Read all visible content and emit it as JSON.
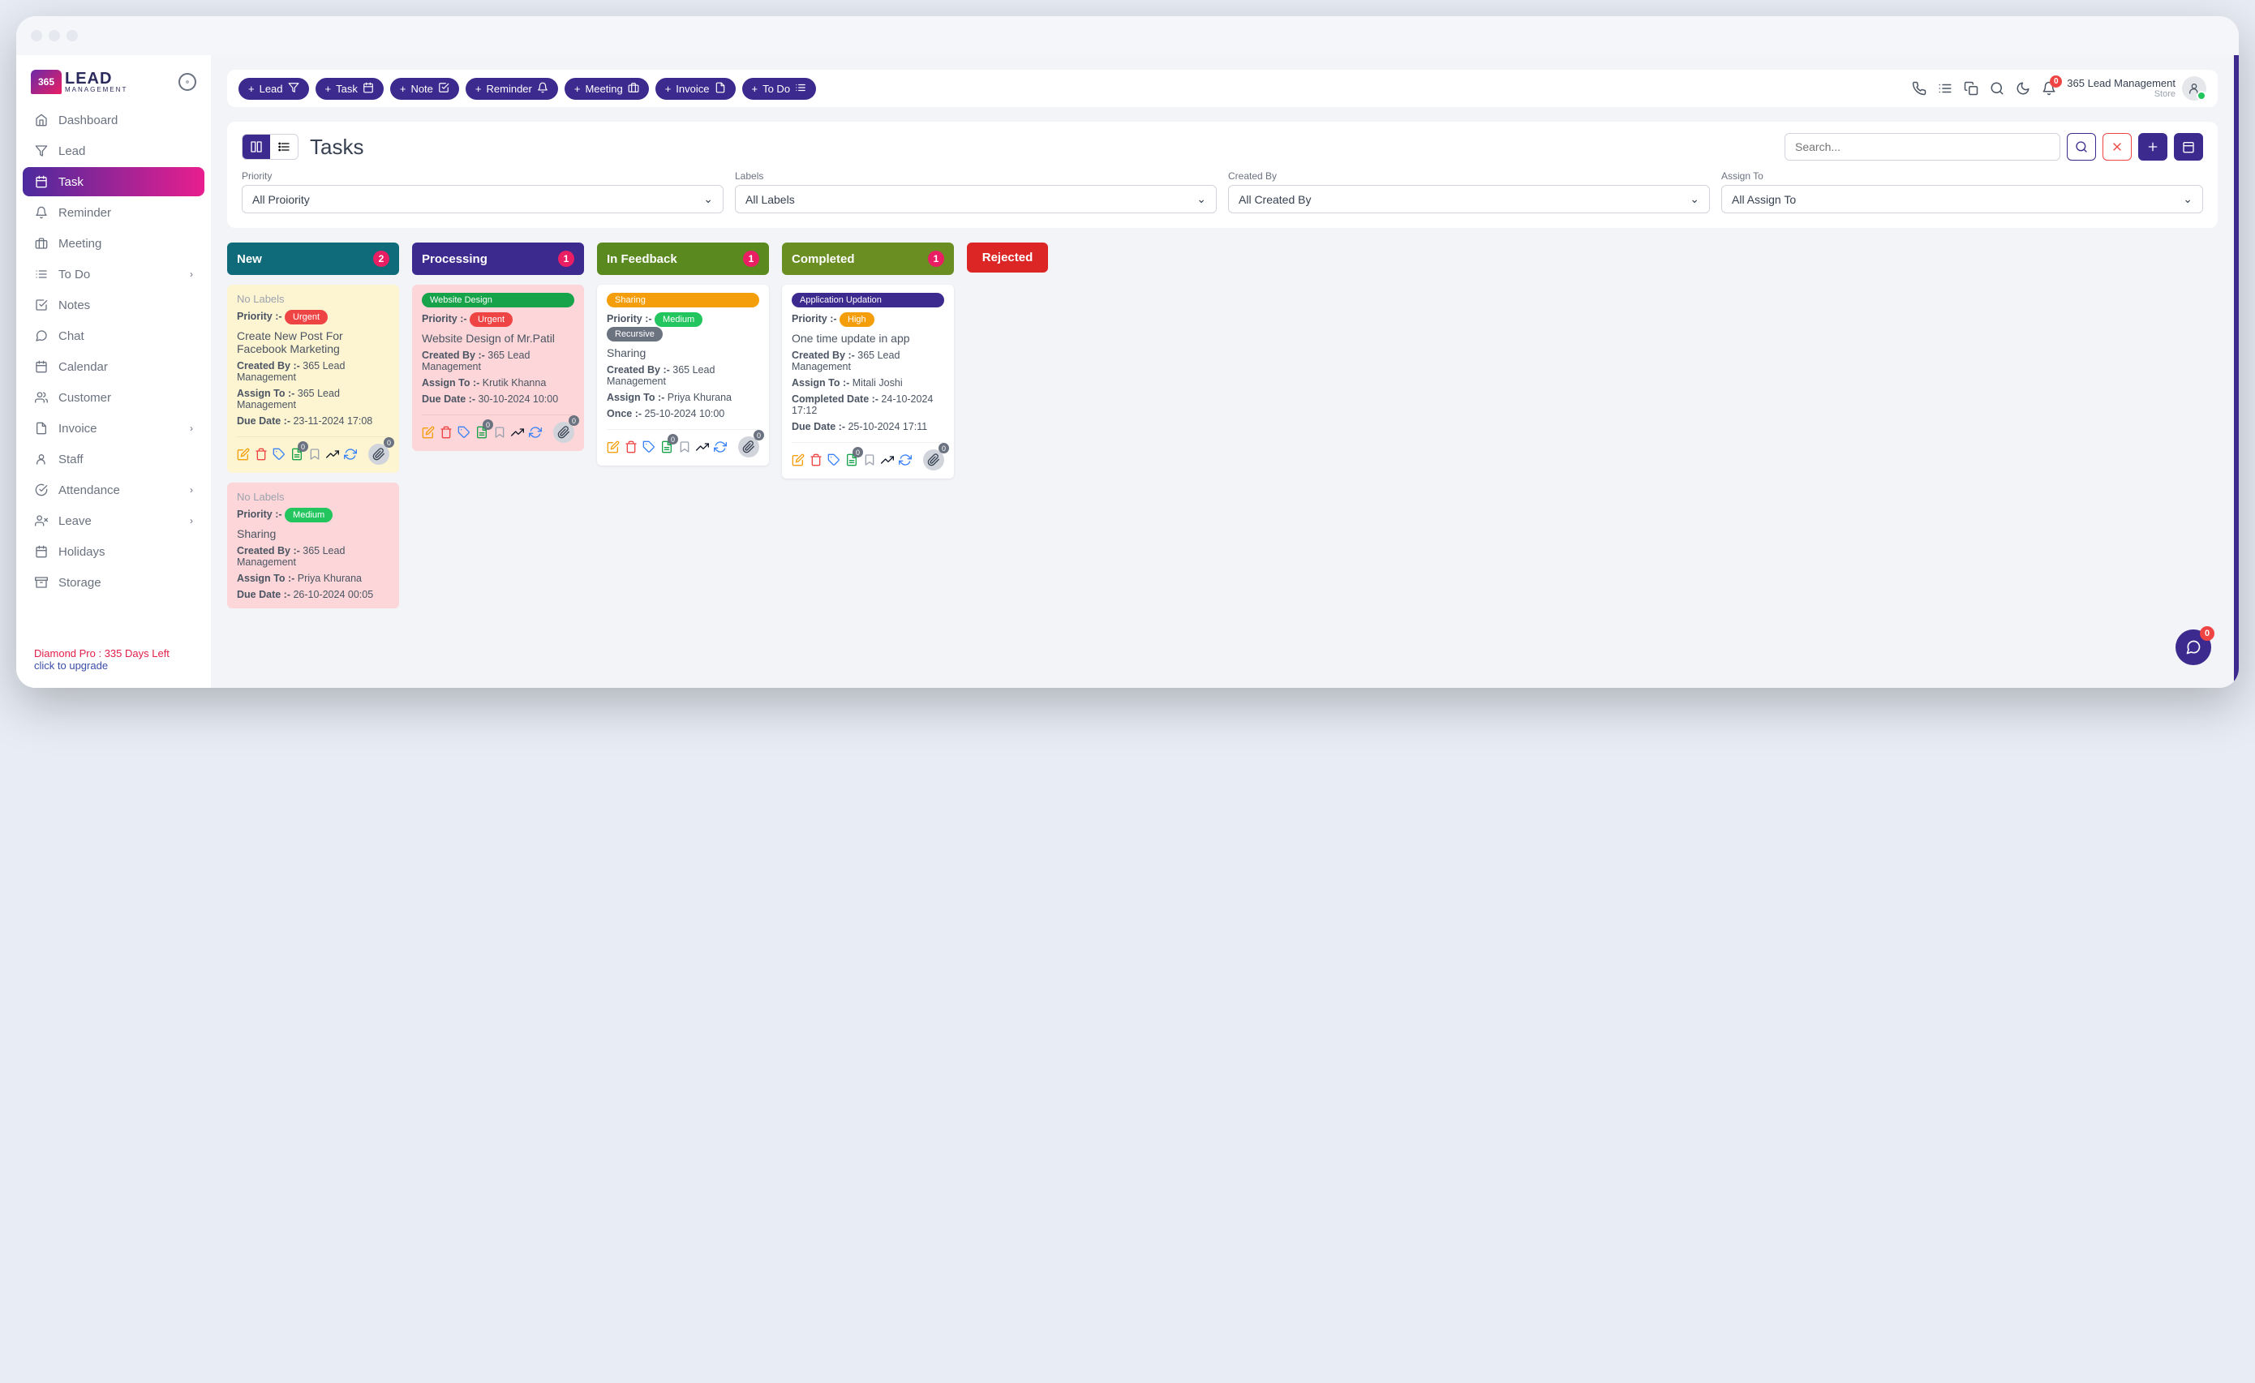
{
  "header": {
    "logo_365": "365",
    "logo_lead": "LEAD",
    "logo_mgmt": "MANAGEMENT",
    "user_name": "365 Lead Management",
    "user_role": "Store",
    "notification_count": "0"
  },
  "toolbar": {
    "pills": [
      {
        "label": "Lead",
        "icon": "funnel"
      },
      {
        "label": "Task",
        "icon": "calendar"
      },
      {
        "label": "Note",
        "icon": "check-square"
      },
      {
        "label": "Reminder",
        "icon": "bell"
      },
      {
        "label": "Meeting",
        "icon": "briefcase"
      },
      {
        "label": "Invoice",
        "icon": "file"
      },
      {
        "label": "To Do",
        "icon": "list"
      }
    ]
  },
  "sidebar": {
    "items": [
      {
        "label": "Dashboard",
        "icon": "home"
      },
      {
        "label": "Lead",
        "icon": "funnel"
      },
      {
        "label": "Task",
        "icon": "calendar",
        "active": true
      },
      {
        "label": "Reminder",
        "icon": "bell"
      },
      {
        "label": "Meeting",
        "icon": "briefcase"
      },
      {
        "label": "To Do",
        "icon": "list",
        "expandable": true
      },
      {
        "label": "Notes",
        "icon": "check-square"
      },
      {
        "label": "Chat",
        "icon": "chat"
      },
      {
        "label": "Calendar",
        "icon": "calendar"
      },
      {
        "label": "Customer",
        "icon": "users"
      },
      {
        "label": "Invoice",
        "icon": "file",
        "expandable": true
      },
      {
        "label": "Staff",
        "icon": "user"
      },
      {
        "label": "Attendance",
        "icon": "check-circle",
        "expandable": true
      },
      {
        "label": "Leave",
        "icon": "user-x",
        "expandable": true
      },
      {
        "label": "Holidays",
        "icon": "calendar"
      },
      {
        "label": "Storage",
        "icon": "archive"
      }
    ],
    "plan": "Diamond Pro : 335 Days Left",
    "upgrade": "click to upgrade"
  },
  "page": {
    "title": "Tasks",
    "search_placeholder": "Search...",
    "filters": [
      {
        "label": "Priority",
        "value": "All Proiority"
      },
      {
        "label": "Labels",
        "value": "All Labels"
      },
      {
        "label": "Created By",
        "value": "All Created By"
      },
      {
        "label": "Assign To",
        "value": "All Assign To"
      }
    ]
  },
  "columns": [
    {
      "title": "New",
      "count": "2",
      "color": "#0f6b7a"
    },
    {
      "title": "Processing",
      "count": "1",
      "color": "#3d2a8f"
    },
    {
      "title": "In Feedback",
      "count": "1",
      "color": "#5a8a1f"
    },
    {
      "title": "Completed",
      "count": "1",
      "color": "#6b8e23"
    },
    {
      "title": "Rejected",
      "count": "",
      "color": "#dc2626"
    }
  ],
  "cards": {
    "new": [
      {
        "label_text": "No Labels",
        "priority_label": "Priority :-",
        "priority": "Urgent",
        "priority_class": "tag-urgent",
        "title": "Create New Post For Facebook Marketing",
        "created_label": "Created By :-",
        "created": "365 Lead Management",
        "assign_label": "Assign To :-",
        "assign": "365 Lead Management",
        "due_label": "Due Date :-",
        "due": "23-11-2024 17:08",
        "bg": "card-yellow"
      },
      {
        "label_text": "No Labels",
        "priority_label": "Priority :-",
        "priority": "Medium",
        "priority_class": "tag-medium",
        "title": "Sharing",
        "created_label": "Created By :-",
        "created": "365 Lead Management",
        "assign_label": "Assign To :-",
        "assign": "Priya Khurana",
        "due_label": "Due Date :-",
        "due": "26-10-2024 00:05",
        "bg": "card-pink"
      }
    ],
    "processing": [
      {
        "label_tag": "Website Design",
        "label_class": "tag-green",
        "priority_label": "Priority :-",
        "priority": "Urgent",
        "priority_class": "tag-urgent",
        "title": "Website Design of Mr.Patil",
        "created_label": "Created By :-",
        "created": "365 Lead Management",
        "assign_label": "Assign To :-",
        "assign": "Krutik Khanna",
        "due_label": "Due Date :-",
        "due": "30-10-2024 10:00",
        "bg": "card-pink"
      }
    ],
    "feedback": [
      {
        "label_tag": "Sharing",
        "label_class": "tag-orange",
        "priority_label": "Priority :-",
        "priority": "Medium",
        "priority_class": "tag-medium",
        "extra_tag": "Recursive",
        "extra_class": "tag-rec",
        "title": "Sharing",
        "created_label": "Created By :-",
        "created": "365 Lead Management",
        "assign_label": "Assign To :-",
        "assign": "Priya Khurana",
        "once_label": "Once :-",
        "once": "25-10-2024 10:00",
        "bg": "card-white"
      }
    ],
    "completed": [
      {
        "label_tag": "Application Updation",
        "label_class": "tag-blue",
        "priority_label": "Priority :-",
        "priority": "High",
        "priority_class": "tag-high",
        "title": "One time update in app",
        "created_label": "Created By :-",
        "created": "365 Lead Management",
        "assign_label": "Assign To :-",
        "assign": "Mitali Joshi",
        "comp_label": "Completed Date :-",
        "comp": "24-10-2024 17:12",
        "due_label": "Due Date :-",
        "due": "25-10-2024 17:11",
        "bg": "card-white"
      }
    ]
  },
  "fab_count": "0",
  "card_footer_badge": "0"
}
